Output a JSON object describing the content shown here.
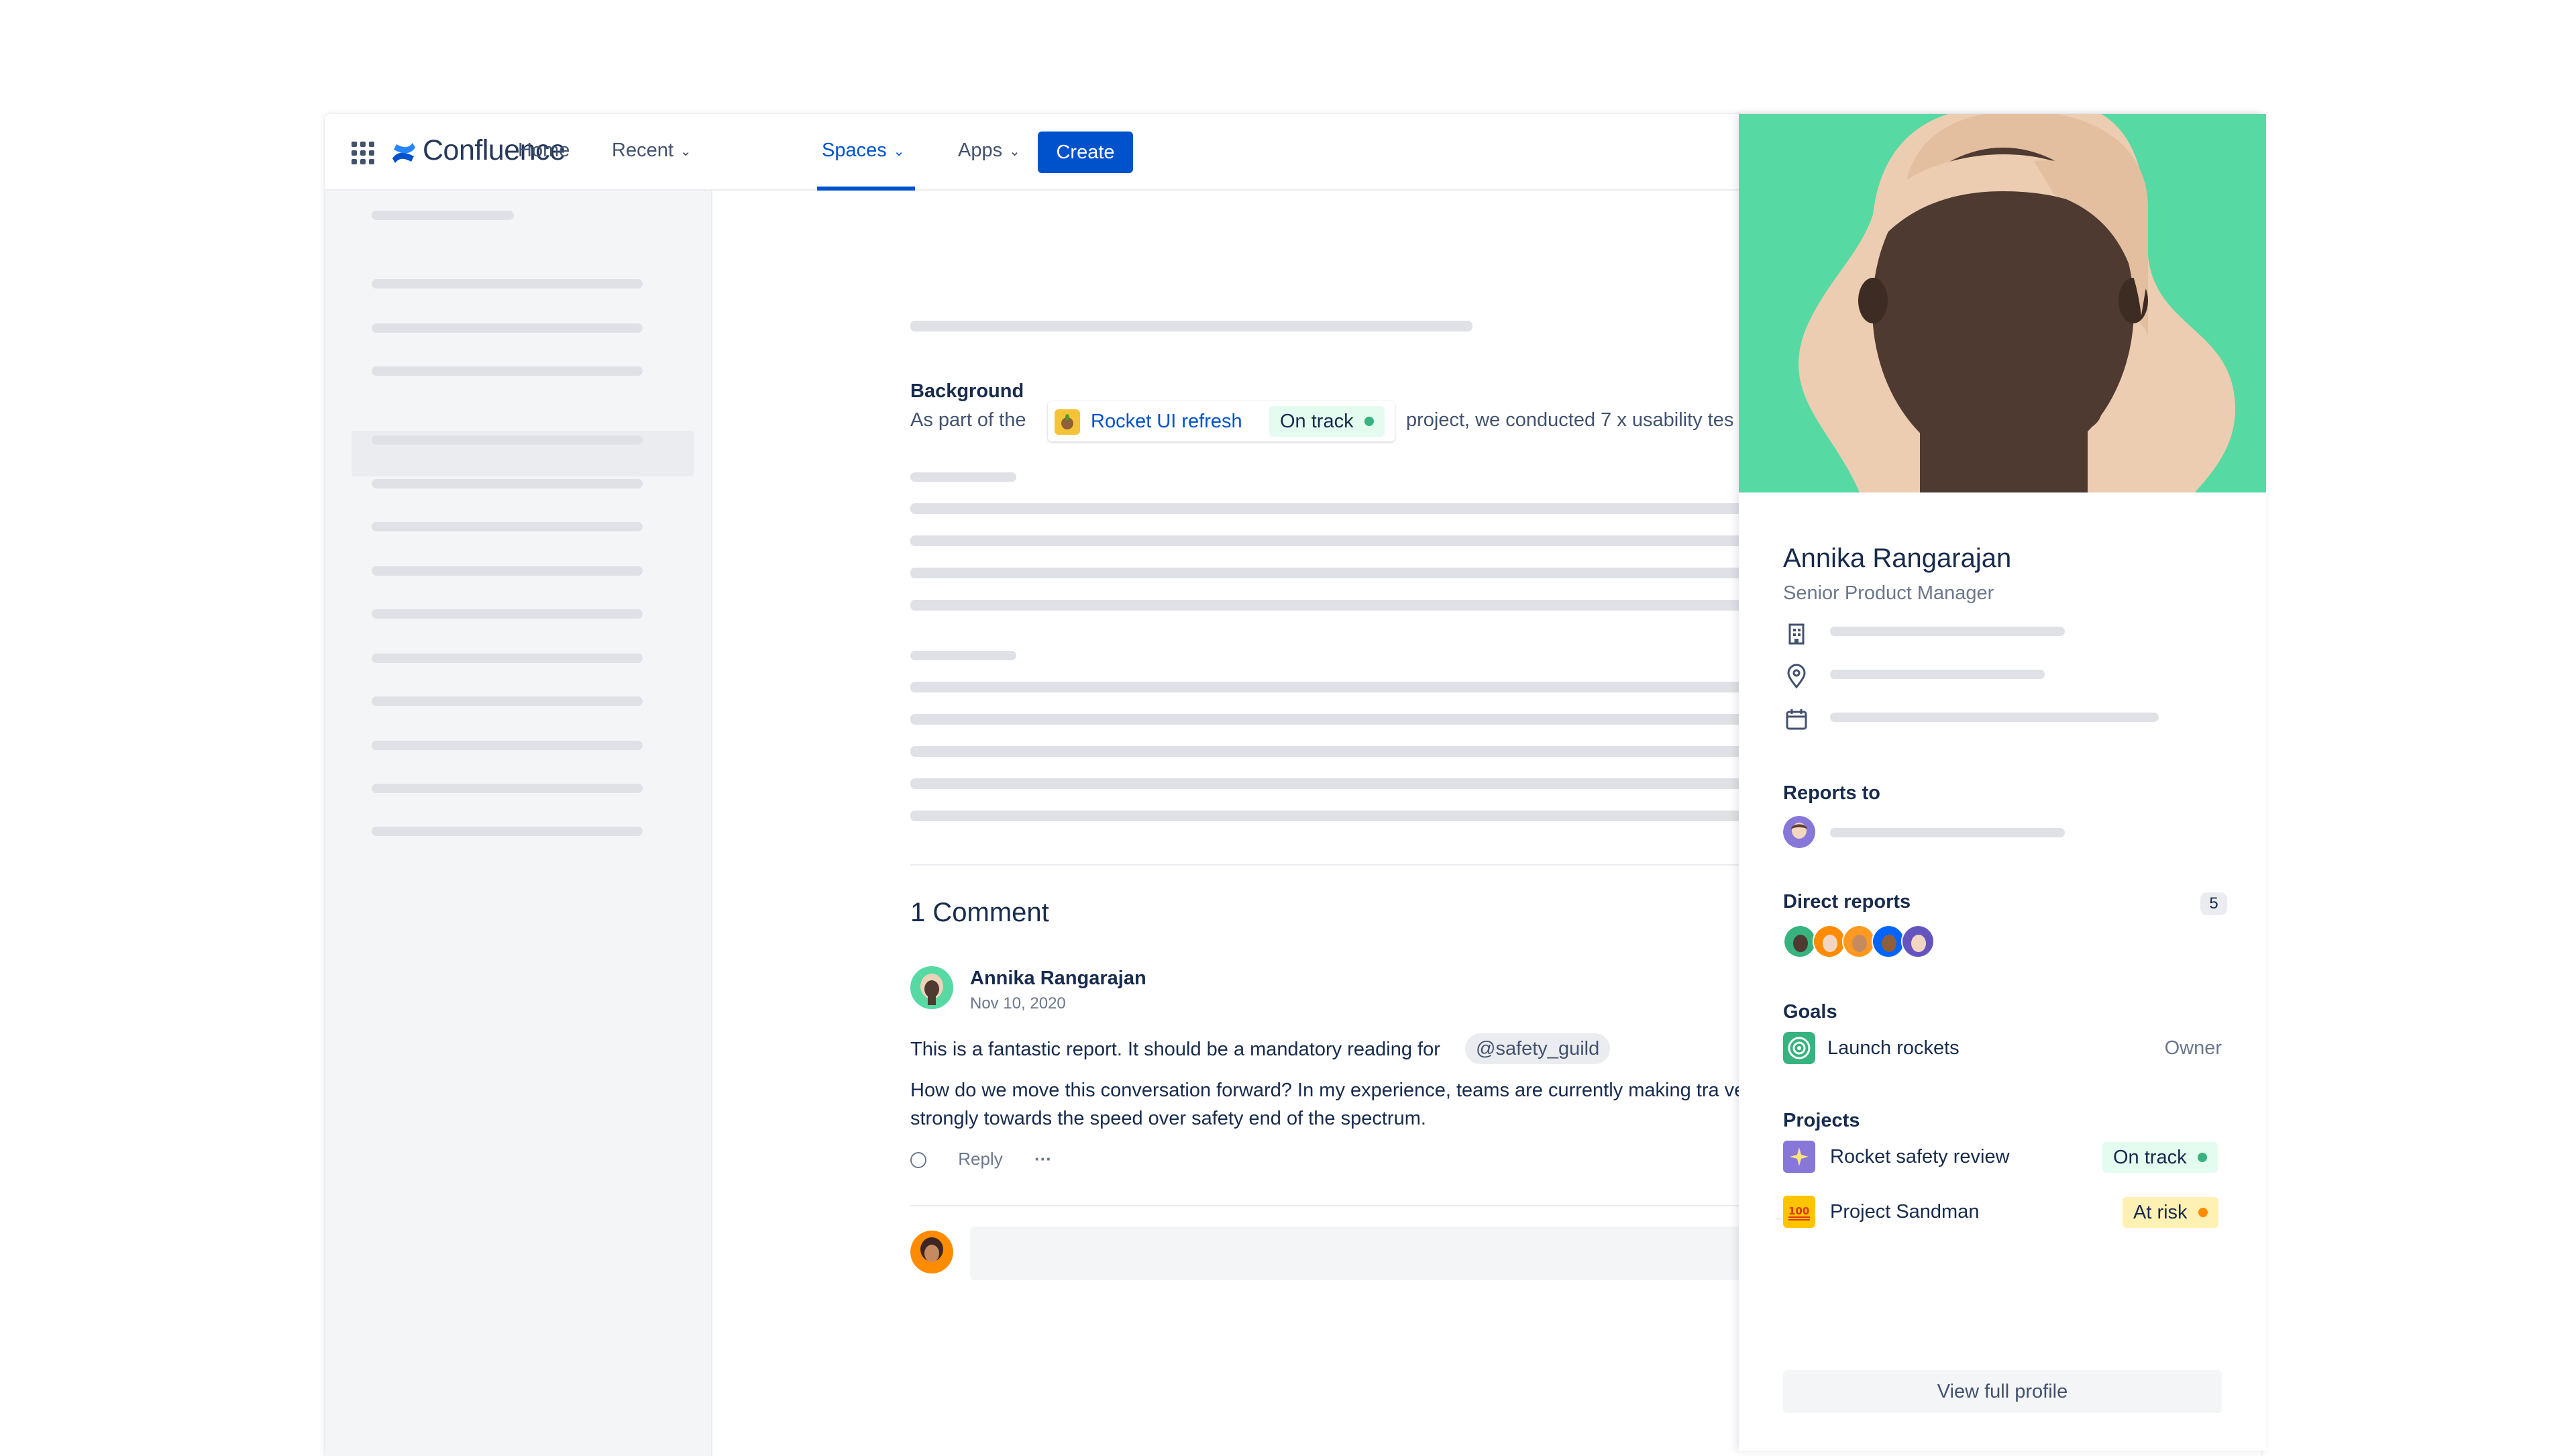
{
  "nav": {
    "logo": "Confluence",
    "home": "Home",
    "recent": "Recent",
    "spaces": "Spaces",
    "apps": "Apps",
    "create": "Create"
  },
  "article": {
    "section_title": "Background",
    "prefix": "As part of the",
    "smart_link_title": "Rocket UI refresh",
    "smart_link_status": "On track",
    "suffix": "project, we conducted 7 x usability tes"
  },
  "comments": {
    "heading": "1 Comment",
    "author": "Annika Rangarajan",
    "date": "Nov 10, 2020",
    "text1": "This is a fantastic report. It should be a mandatory reading for",
    "mention": "@safety_guild",
    "text2": "How do we move this conversation forward? In my experience, teams are currently making tra very strongly towards the speed over safety end of the spectrum.",
    "reply": "Reply",
    "more": "···"
  },
  "profile": {
    "name": "Annika Rangarajan",
    "title": "Senior Product Manager",
    "reports_to_label": "Reports to",
    "direct_reports_label": "Direct reports",
    "direct_reports_count": "5",
    "goals_label": "Goals",
    "goal_name": "Launch rockets",
    "goal_role": "Owner",
    "projects_label": "Projects",
    "projects": [
      {
        "name": "Rocket safety review",
        "status": "On track"
      },
      {
        "name": "Project Sandman",
        "status": "At risk"
      }
    ],
    "view_full_profile": "View full profile"
  },
  "colors": {
    "brand_blue": "#0052CC",
    "hero_green": "#57D9A3",
    "on_track_dot": "#36B37E",
    "at_risk_dot": "#FF8B00"
  }
}
